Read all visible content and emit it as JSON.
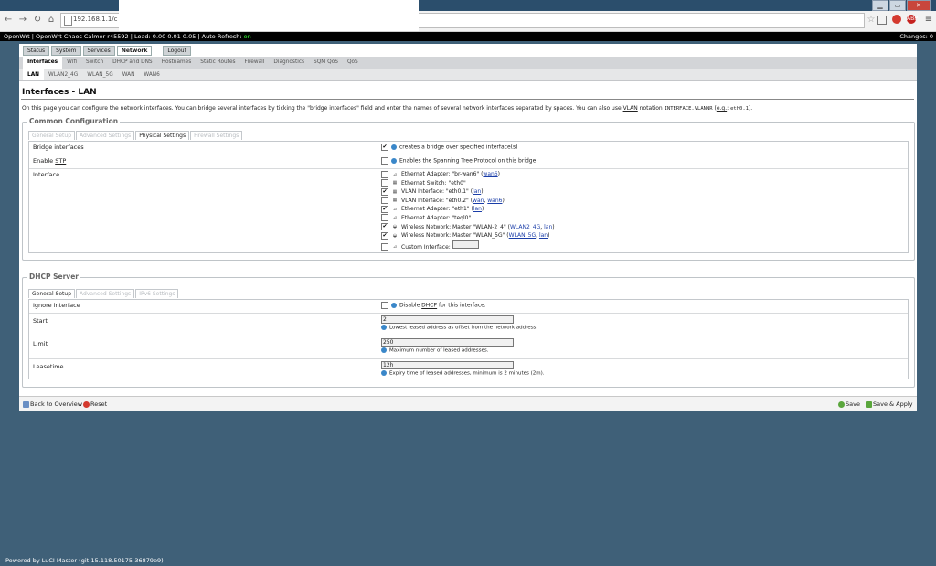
{
  "browser": {
    "url": "192.168.1.1/c",
    "window_buttons": [
      "▁",
      "▭",
      "✕"
    ]
  },
  "luci_bar": {
    "left_text": "OpenWrt | OpenWrt Chaos Calmer r45592 | Load: 0.00 0.01 0.05 | Auto Refresh: ",
    "auto_refresh_value": "on",
    "changes": "Changes: 0"
  },
  "top_tabs": [
    "Status",
    "System",
    "Services",
    "Network",
    "Logout"
  ],
  "subnav": [
    "Interfaces",
    "Wifi",
    "Switch",
    "DHCP and DNS",
    "Hostnames",
    "Static Routes",
    "Firewall",
    "Diagnostics",
    "SQM QoS",
    "QoS"
  ],
  "ifnav": [
    "LAN",
    "WLAN2_4G",
    "WLAN_5G",
    "WAN",
    "WAN6"
  ],
  "page": {
    "title": "Interfaces - LAN",
    "desc_a": "On this page you can configure the network interfaces. You can bridge several interfaces by ticking the \"bridge interfaces\" field and enter the names of several network interfaces separated by spaces. You can also use ",
    "desc_vlan": "VLAN",
    "desc_b": " notation ",
    "desc_code1": "INTERFACE.VLANNR",
    "desc_c": " (",
    "desc_eg": "e.g.",
    "desc_d": ": ",
    "desc_code2": "eth0.1",
    "desc_e": ")."
  },
  "common": {
    "legend": "Common Configuration",
    "tabs": [
      "General Setup",
      "Advanced Settings",
      "Physical Settings",
      "Firewall Settings"
    ],
    "bridge_label": "Bridge interfaces",
    "bridge_desc": "creates a bridge over specified interface(s)",
    "stp_label_a": "Enable ",
    "stp_label_b": "STP",
    "stp_desc": "Enables the Spanning Tree Protocol on this bridge",
    "interface_label": "Interface",
    "interfaces": [
      {
        "text": "Ethernet Adapter: \"br-wan6\" (",
        "links": [
          "wan6"
        ],
        "checked": false
      },
      {
        "text": "Ethernet Switch: \"eth0\"",
        "links": [],
        "checked": false
      },
      {
        "text": "VLAN Interface: \"eth0.1\" (",
        "links": [
          "lan"
        ],
        "checked": true
      },
      {
        "text": "VLAN Interface: \"eth0.2\" (",
        "links": [
          "wan",
          "wan6"
        ],
        "checked": false
      },
      {
        "text": "Ethernet Adapter: \"eth1\" (",
        "links": [
          "lan"
        ],
        "checked": true
      },
      {
        "text": "Ethernet Adapter: \"teql0\"",
        "links": [],
        "checked": false
      },
      {
        "text": "Wireless Network: Master \"WLAN-2_4\" (",
        "links": [
          "WLAN2_4G",
          "lan"
        ],
        "checked": true
      },
      {
        "text": "Wireless Network: Master \"WLAN_5G\" (",
        "links": [
          "WLAN_5G",
          "lan"
        ],
        "checked": true
      },
      {
        "text": "Custom Interface:",
        "links": [],
        "checked": false
      }
    ]
  },
  "dhcp": {
    "legend": "DHCP Server",
    "tabs": [
      "General Setup",
      "Advanced Settings",
      "IPv6 Settings"
    ],
    "ignore_label": "Ignore interface",
    "ignore_desc_a": "Disable ",
    "ignore_desc_b": "DHCP",
    "ignore_desc_c": " for this interface.",
    "start_label": "Start",
    "start_value": "2",
    "start_desc": "Lowest leased address as offset from the network address.",
    "limit_label": "Limit",
    "limit_value": "250",
    "limit_desc": "Maximum number of leased addresses.",
    "lease_label": "Leasetime",
    "lease_value": "12h",
    "lease_desc": "Expiry time of leased addresses, minimum is 2 minutes (2m)."
  },
  "footer": {
    "back": "Back to Overview",
    "reset": "Reset",
    "save": "Save",
    "save_apply": "Save & Apply"
  },
  "powered": "Powered by LuCI Master (git-15.118.50175-36879e9)",
  "colors": {
    "bg": "#3f6078",
    "accent": "#1a3da8",
    "on": "#33ff33"
  }
}
